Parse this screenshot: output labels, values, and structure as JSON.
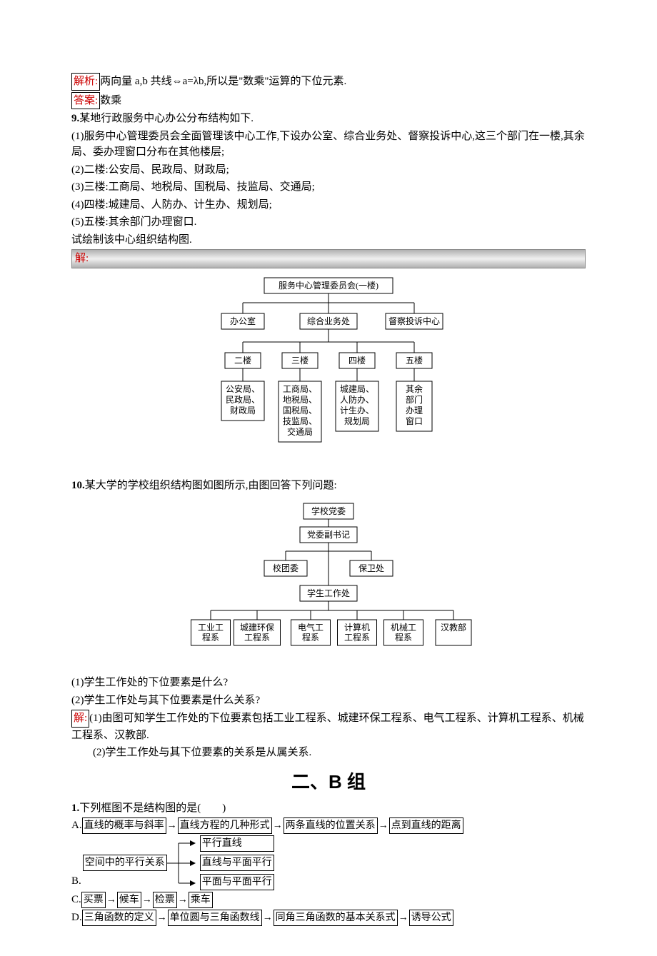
{
  "q8": {
    "analysis_label": "解析:",
    "analysis_text": "两向量 a,b 共线⇔a=λb,所以是\"数乘\"运算的下位元素.",
    "answer_label": "答案:",
    "answer_text": "数乘"
  },
  "q9": {
    "num": "9.",
    "intro": "某地行政服务中心办公分布结构如下.",
    "item1": "(1)服务中心管理委员会全面管理该中心工作,下设办公室、综合业务处、督察投诉中心,这三个部门在一楼,其余局、委办理窗口分布在其他楼层;",
    "item2": "(2)二楼:公安局、民政局、财政局;",
    "item3": "(3)三楼:工商局、地税局、国税局、技监局、交通局;",
    "item4": "(4)四楼:城建局、人防办、计生办、规划局;",
    "item5": "(5)五楼:其余部门办理窗口.",
    "task": "试绘制该中心组织结构图.",
    "sol_label": "解:",
    "diagram": {
      "top": "服务中心管理委员会(一楼)",
      "l1": [
        "办公室",
        "综合业务处",
        "督察投诉中心"
      ],
      "l2": [
        "二楼",
        "三楼",
        "四楼",
        "五楼"
      ],
      "l3": [
        "公安局、\n民政局、\n财政局",
        "工商局、\n地税局、\n国税局、\n技监局、\n交通局",
        "城建局、\n人防办、\n计生办、\n规划局",
        "其余\n部门\n办理\n窗口"
      ]
    }
  },
  "q10": {
    "num": "10.",
    "intro": "某大学的学校组织结构图如图所示,由图回答下列问题:",
    "diagram": {
      "a": "学校党委",
      "b": "党委副书记",
      "c1": "校团委",
      "c2": "保卫处",
      "d": "学生工作处",
      "e": [
        "工业工\n程系",
        "城建环保\n工程系",
        "电气工\n程系",
        "计算机\n工程系",
        "机械工\n程系",
        "汉教部"
      ]
    },
    "q1": "(1)学生工作处的下位要素是什么?",
    "q2": "(2)学生工作处与其下位要素是什么关系?",
    "sol_label": "解:",
    "sol1": "(1)由图可知学生工作处的下位要素包括工业工程系、城建环保工程系、电气工程系、计算机工程系、机械工程系、汉教部.",
    "sol2": "(2)学生工作处与其下位要素的关系是从属关系."
  },
  "groupB": {
    "title": "二、B 组",
    "q1": {
      "num": "1.",
      "stem": "下列框图不是结构图的是(　　)",
      "A": {
        "b1": "直线的概率与斜率",
        "b2": "直线方程的几种形式",
        "b3": "两条直线的位置关系",
        "b4": "点到直线的距离"
      },
      "B": {
        "left": "空间中的平行关系",
        "r1": "平行直线",
        "r2": "直线与平面平行",
        "r3": "平面与平面平行"
      },
      "C": {
        "b1": "买票",
        "b2": "候车",
        "b3": "检票",
        "b4": "乘车"
      },
      "D": {
        "b1": "三角函数的定义",
        "b2": "单位圆与三角函数线",
        "b3": "同角三角函数的基本关系式",
        "b4": "诱导公式"
      }
    }
  }
}
